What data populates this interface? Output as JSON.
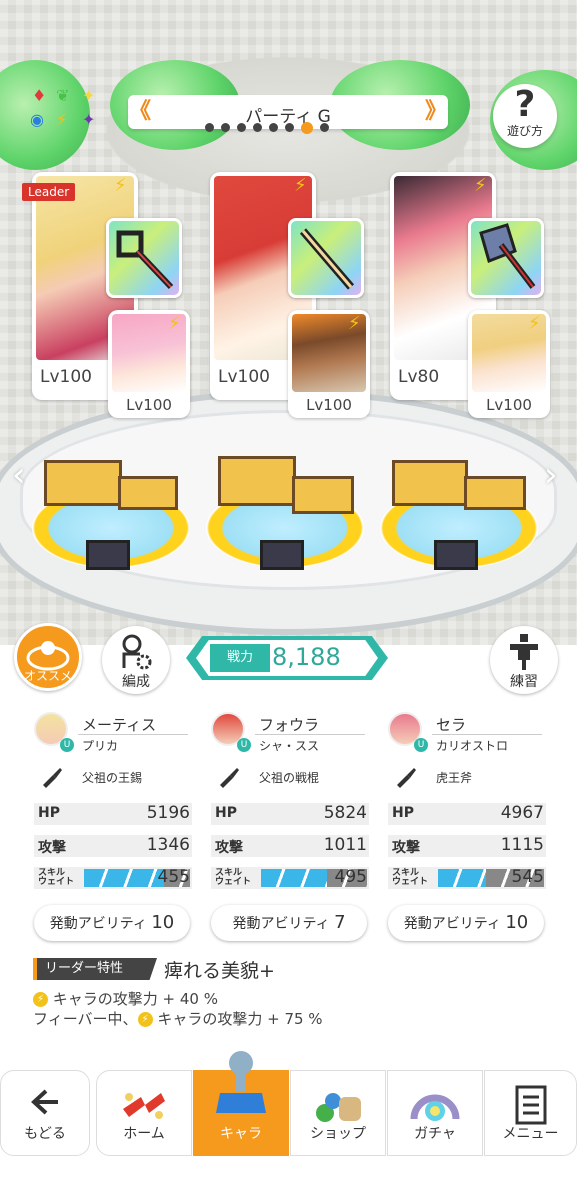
{
  "header": {
    "party_name": "パーティ G",
    "prev_arrow": "《",
    "next_arrow": "》",
    "page_count": 8,
    "active_page": 7,
    "help_label": "遊び方"
  },
  "party": [
    {
      "main_level": "Lv100",
      "leader_tag": "Leader",
      "sub_level": "Lv100",
      "main_name": "メーティス",
      "sub_name": "プリカ",
      "weapon": "父祖の王錫",
      "hp": "5196",
      "attack": "1346",
      "skill_wait": "455",
      "skill_wait_fill": 0.75,
      "ability_label": "発動アビリティ",
      "ability_count": "10",
      "colors": {
        "hair": "#f4e3a0",
        "sub_hair": "#f7a6c4"
      }
    },
    {
      "main_level": "Lv100",
      "sub_level": "Lv100",
      "main_name": "フォウラ",
      "sub_name": "シャ・スス",
      "weapon": "父祖の戦棍",
      "hp": "5824",
      "attack": "1011",
      "skill_wait": "495",
      "skill_wait_fill": 0.62,
      "ability_label": "発動アビリティ",
      "ability_count": "7",
      "colors": {
        "hair": "#e0493e",
        "sub_hair": "#7a4a2a"
      }
    },
    {
      "main_level": "Lv80",
      "sub_level": "Lv100",
      "main_name": "セラ",
      "sub_name": "カリオストロ",
      "weapon": "虎王斧",
      "hp": "4967",
      "attack": "1115",
      "skill_wait": "545",
      "skill_wait_fill": 0.45,
      "ability_label": "発動アビリティ",
      "ability_count": "10",
      "colors": {
        "hair": "#e97a8e",
        "sub_hair": "#f3dc9e"
      }
    }
  ],
  "actions": {
    "recommend_label": "オススメ",
    "edit_label": "編成",
    "practice_label": "練習"
  },
  "power": {
    "label": "戦力",
    "value": "8,188"
  },
  "stat_labels": {
    "hp": "HP",
    "attack": "攻撃",
    "skill_wait_line1": "スキル",
    "skill_wait_line2": "ウェイト"
  },
  "leader_skill": {
    "label": "リーダー特性",
    "name": "痺れる美貌+",
    "effect1": "キャラの攻撃力 + 40 %",
    "effect2_prefix": "フィーバー中、",
    "effect2": "キャラの攻撃力 + 75 %"
  },
  "nav": {
    "back": "もどる",
    "home": "ホーム",
    "chara": "キャラ",
    "shop": "ショップ",
    "gacha": "ガチャ",
    "menu": "メニュー"
  },
  "colors": {
    "accent": "#f59a1c",
    "teal": "#2fb8a8",
    "skill_bar": "#3bb6e8"
  }
}
